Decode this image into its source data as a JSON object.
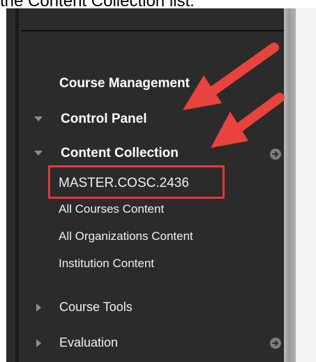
{
  "caption": "the Content Collection list.",
  "menu": {
    "section_title": "Course Management",
    "control_panel": "Control Panel",
    "content_collection": {
      "label": "Content Collection",
      "items": [
        "MASTER.COSC.2436",
        "All Courses Content",
        "All Organizations Content",
        "Institution Content"
      ]
    },
    "course_tools": "Course Tools",
    "evaluation": "Evaluation"
  },
  "colors": {
    "panel_bg": "#2b2b2b",
    "highlight": "#e5383b",
    "annotation_arrow": "#e8433e",
    "text": "#ffffff"
  }
}
